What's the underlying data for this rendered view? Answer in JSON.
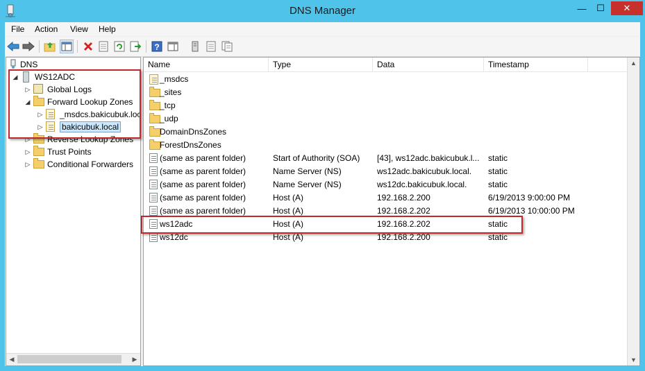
{
  "window": {
    "title": "DNS Manager",
    "minimize": "—",
    "maximize": "☐",
    "close": "✕"
  },
  "menu": [
    "File",
    "Action",
    "View",
    "Help"
  ],
  "tree": {
    "root": "DNS",
    "server": "WS12ADC",
    "global_logs": "Global Logs",
    "forward_zones": "Forward Lookup Zones",
    "msdcs_zone": "_msdcs.bakicubuk.local",
    "bakicubuk_zone": "bakicubuk.local",
    "reverse_zones": "Reverse Lookup Zones",
    "trust_points": "Trust Points",
    "conditional_forwarders": "Conditional Forwarders"
  },
  "columns": {
    "name": "Name",
    "type": "Type",
    "data": "Data",
    "timestamp": "Timestamp"
  },
  "folders": [
    "_msdcs",
    "_sites",
    "_tcp",
    "_udp",
    "DomainDnsZones",
    "ForestDnsZones"
  ],
  "records": [
    {
      "name": "(same as parent folder)",
      "type": "Start of Authority (SOA)",
      "data": "[43], ws12adc.bakicubuk.l...",
      "timestamp": "static"
    },
    {
      "name": "(same as parent folder)",
      "type": "Name Server (NS)",
      "data": "ws12adc.bakicubuk.local.",
      "timestamp": "static"
    },
    {
      "name": "(same as parent folder)",
      "type": "Name Server (NS)",
      "data": "ws12dc.bakicubuk.local.",
      "timestamp": "static"
    },
    {
      "name": "(same as parent folder)",
      "type": "Host (A)",
      "data": "192.168.2.200",
      "timestamp": "6/19/2013 9:00:00 PM"
    },
    {
      "name": "(same as parent folder)",
      "type": "Host (A)",
      "data": "192.168.2.202",
      "timestamp": "6/19/2013 10:00:00 PM"
    },
    {
      "name": "ws12adc",
      "type": "Host (A)",
      "data": "192.168.2.202",
      "timestamp": "static"
    },
    {
      "name": "ws12dc",
      "type": "Host (A)",
      "data": "192.168.2.200",
      "timestamp": "static"
    }
  ],
  "colors": {
    "titlebar": "#4fc3ea",
    "close_button": "#c7302b",
    "highlight_box": "#c0272d",
    "selection": "#cce8ff"
  }
}
